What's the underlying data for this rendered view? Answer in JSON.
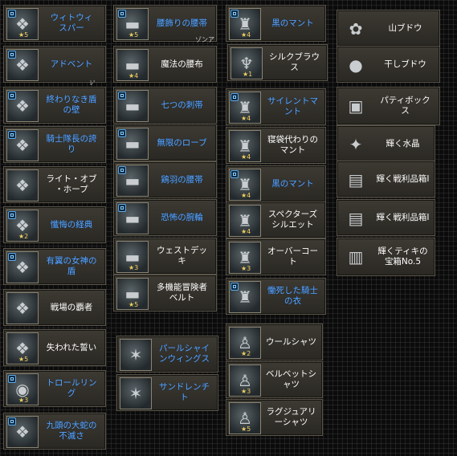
{
  "items": [
    {
      "name": "ウィスパー",
      "label": "ウィトウィ\nスパー",
      "stars": "5",
      "color": "blue",
      "icon": "cape-icon",
      "glyph": "❖",
      "badge": true
    },
    {
      "name": "アドベント",
      "label": "アドベント",
      "stars": "",
      "color": "blue",
      "icon": "cape-icon",
      "glyph": "❖",
      "badge": true
    },
    {
      "name": "終わりなき盾の壁",
      "label": "終わりなき盾\nの壁",
      "stars": "",
      "color": "blue",
      "icon": "cape-icon",
      "glyph": "❖",
      "badge": true
    },
    {
      "name": "騎士隊長の誇り",
      "label": "騎士隊長の誇\nり",
      "stars": "",
      "color": "blue",
      "icon": "cape-icon",
      "glyph": "❖",
      "badge": true
    },
    {
      "name": "ライト・オブ・ホープ",
      "label": "ライト・オブ\n・ホープ",
      "stars": "",
      "color": "white",
      "icon": "cape-icon",
      "glyph": "❖",
      "badge": false
    },
    {
      "name": "懺悔の経典",
      "label": "懺悔の経典",
      "stars": "2",
      "color": "blue",
      "icon": "cape-icon",
      "glyph": "❖",
      "badge": true
    },
    {
      "name": "有翼の女神の盾",
      "label": "有翼の女神の\n盾",
      "stars": "",
      "color": "blue",
      "icon": "cape-icon",
      "glyph": "❖",
      "badge": true
    },
    {
      "name": "戦場の覇者",
      "label": "戦場の覇者",
      "stars": "",
      "color": "white",
      "icon": "cape-icon",
      "glyph": "❖",
      "badge": false
    },
    {
      "name": "失われた誓い",
      "label": "失われた誓い",
      "stars": "5",
      "color": "white",
      "icon": "cape-icon",
      "glyph": "❖",
      "badge": false
    },
    {
      "name": "トロールリング",
      "label": "トロールリン\nグ",
      "stars": "3",
      "color": "blue",
      "icon": "ring-icon",
      "glyph": "◉",
      "badge": true
    },
    {
      "name": "九頭の大蛇の不滅さ",
      "label": "九頭の大蛇の\n不滅さ",
      "stars": "",
      "color": "blue",
      "icon": "cape-icon",
      "glyph": "❖",
      "badge": true
    },
    {
      "name": "腰飾りの腰帯",
      "label": "腰飾りの腰帯",
      "stars": "5",
      "color": "blue",
      "icon": "belt-icon",
      "glyph": "▬",
      "badge": true
    },
    {
      "name": "魔法の腰布",
      "label": "魔法の腰布",
      "stars": "4",
      "color": "white",
      "icon": "belt-icon",
      "glyph": "▬",
      "badge": false
    },
    {
      "name": "七つの刺帯",
      "label": "七つの刺帯",
      "stars": "",
      "color": "blue",
      "icon": "belt-icon",
      "glyph": "▬",
      "badge": true
    },
    {
      "name": "無限のローブ",
      "label": "無限のローブ",
      "stars": "",
      "color": "blue",
      "icon": "belt-icon",
      "glyph": "▬",
      "badge": true
    },
    {
      "name": "鶏羽の腰帯",
      "label": "鶏羽の腰帯",
      "stars": "",
      "color": "blue",
      "icon": "belt-icon",
      "glyph": "▬",
      "badge": true
    },
    {
      "name": "恐怖の腕輪",
      "label": "恐怖の腕輪",
      "stars": "",
      "color": "blue",
      "icon": "belt-icon",
      "glyph": "▬",
      "badge": true
    },
    {
      "name": "ウェストデッキ",
      "label": "ウェストデッ\nキ",
      "stars": "3",
      "color": "white",
      "icon": "belt-icon",
      "glyph": "▬",
      "badge": false
    },
    {
      "name": "多機能冒険者ベルト",
      "label": "多機能冒険者\nベルト",
      "stars": "5",
      "color": "white",
      "icon": "belt-icon",
      "glyph": "▬",
      "badge": false
    },
    {
      "name": "パールシャインウィングス",
      "label": "パールシャイ\nンウィングス",
      "stars": "",
      "color": "blue",
      "icon": "wings-icon",
      "glyph": "✶",
      "badge": false
    },
    {
      "name": "サンドレンチト",
      "label": "サンドレンチ\nト",
      "stars": "",
      "color": "blue",
      "icon": "wings-icon",
      "glyph": "✶",
      "badge": false
    },
    {
      "name": "黒のマント",
      "label": "黒のマント",
      "stars": "4",
      "color": "blue",
      "icon": "cloak-icon",
      "glyph": "♜",
      "badge": true
    },
    {
      "name": "シルクブラウス",
      "label": "シルクブラウ\nス",
      "stars": "1",
      "color": "white",
      "icon": "blouse-icon",
      "glyph": "♆",
      "badge": false
    },
    {
      "name": "サイレントマント",
      "label": "サイレントマ\nント",
      "stars": "4",
      "color": "blue",
      "icon": "cloak-icon",
      "glyph": "♜",
      "badge": true
    },
    {
      "name": "寝袋代わりのマント",
      "label": "寝袋代わりの\nマント",
      "stars": "4",
      "color": "white",
      "icon": "cloak-icon",
      "glyph": "♜",
      "badge": false
    },
    {
      "name": "黒のマント2",
      "label": "黒のマント",
      "stars": "4",
      "color": "blue",
      "icon": "cloak-icon",
      "glyph": "♜",
      "badge": true
    },
    {
      "name": "スペクターズシルエット",
      "label": "スペクターズ\nシルエット",
      "stars": "4",
      "color": "white",
      "icon": "cloak-icon",
      "glyph": "♜",
      "badge": false
    },
    {
      "name": "オーバーコート",
      "label": "オーバーコー\nト",
      "stars": "3",
      "color": "white",
      "icon": "coat-icon",
      "glyph": "♜",
      "badge": false
    },
    {
      "name": "慟死した騎士の衣",
      "label": "慟死した騎士\nの衣",
      "stars": "",
      "color": "blue",
      "icon": "cloak-icon",
      "glyph": "♜",
      "badge": true
    },
    {
      "name": "ウールシャツ",
      "label": "ウールシャツ",
      "stars": "2",
      "color": "white",
      "icon": "shirt-icon",
      "glyph": "♙",
      "badge": false
    },
    {
      "name": "ベルベットシャツ",
      "label": "ベルベットシ\nャツ",
      "stars": "3",
      "color": "white",
      "icon": "shirt-icon",
      "glyph": "♙",
      "badge": false
    },
    {
      "name": "ラグジュアリーシャツ",
      "label": "ラグジュアリ\nーシャツ",
      "stars": "5",
      "color": "white",
      "icon": "shirt-icon",
      "glyph": "♙",
      "badge": false
    },
    {
      "name": "山ブドウ",
      "label": "山ブドウ",
      "stars": "",
      "color": "white",
      "icon": "grapes-icon",
      "glyph": "✿",
      "badge": false
    },
    {
      "name": "干しブドウ",
      "label": "干しブドウ",
      "stars": "",
      "color": "white",
      "icon": "raisins-icon",
      "glyph": "●",
      "badge": false
    },
    {
      "name": "パティボックス",
      "label": "パティボック\nス",
      "stars": "",
      "color": "white",
      "icon": "box-icon",
      "glyph": "▣",
      "badge": false
    },
    {
      "name": "輝く水晶",
      "label": "輝く水晶",
      "stars": "",
      "color": "white",
      "icon": "crystal-icon",
      "glyph": "✦",
      "badge": false
    },
    {
      "name": "輝く戦利品箱I",
      "label": "輝く戦利品箱Ⅰ",
      "stars": "",
      "color": "white",
      "icon": "chest-icon",
      "glyph": "▤",
      "badge": false
    },
    {
      "name": "輝く戦利品箱II",
      "label": "輝く戦利品箱Ⅰ",
      "stars": "",
      "color": "white",
      "icon": "chest-icon",
      "glyph": "▤",
      "badge": false
    },
    {
      "name": "輝くティキの宝箱No.5",
      "label": "輝くティキの\n宝箱No.5",
      "stars": "",
      "color": "white",
      "icon": "treasure-icon",
      "glyph": "▥",
      "badge": false
    }
  ],
  "stray": [
    "ゾンア",
    "ﾚ'"
  ],
  "colors": {
    "blue": "#5aa6ff",
    "white": "#ffffff",
    "star": "#f0d060"
  }
}
